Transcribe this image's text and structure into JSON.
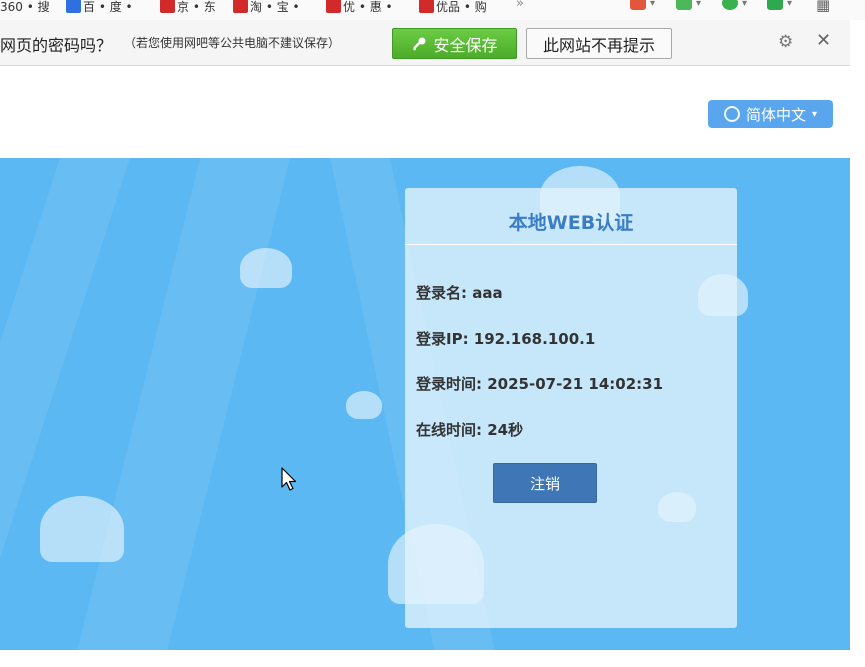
{
  "bookmarks": {
    "items": [
      {
        "label": "360 • 搜"
      },
      {
        "label": "百 • 度 •"
      },
      {
        "label": "京 • 东"
      },
      {
        "label": "淘 • 宝 •"
      },
      {
        "label": "优 • 惠 •"
      },
      {
        "label": "优品 • 购"
      }
    ],
    "more": "»"
  },
  "password_bar": {
    "message": "网页的密码吗？",
    "note": "（若您使用网吧等公共电脑不建议保存）",
    "save_label": "安全保存",
    "never_label": "此网站不再提示",
    "gear": "⚙",
    "close": "✕"
  },
  "header": {
    "language": "简体中文",
    "caret": "▾"
  },
  "card": {
    "title": "本地WEB认证",
    "login_name": "登录名: aaa",
    "login_ip": "登录IP: 192.168.100.1",
    "login_time": "登录时间: 2025-07-21 14:02:31",
    "online_time": "在线时间: 24秒",
    "logout_label": "注销"
  },
  "colors": {
    "hero_bg": "#5cb8f2",
    "save_green": "#4cab2a",
    "logout_blue": "#3f77b6",
    "title_blue": "#3a7dc4"
  }
}
